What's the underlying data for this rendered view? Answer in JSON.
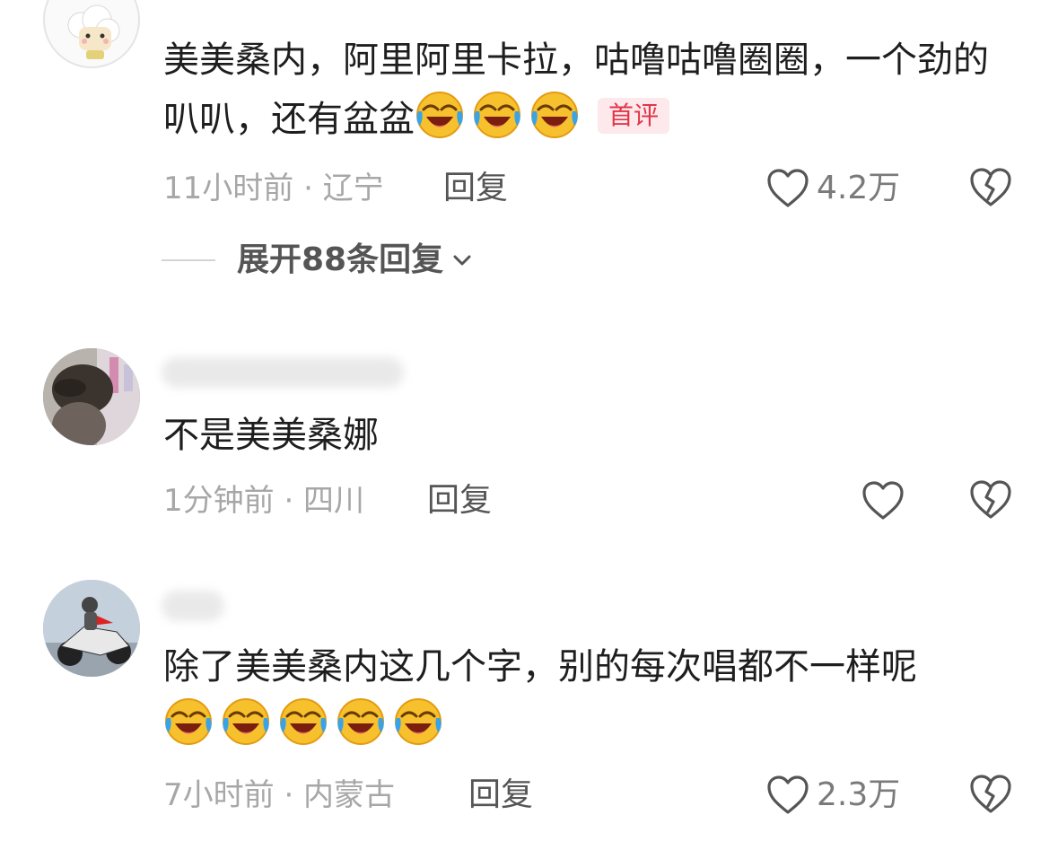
{
  "comments": [
    {
      "text": "美美桑内，阿里阿里卡拉，咕噜咕噜圈圈，一个劲的叭叭，还有盆盆",
      "emoji": [
        "laugh-cry",
        "laugh-cry",
        "laugh-cry"
      ],
      "badge": "首评",
      "meta": "11小时前 · 辽宁",
      "reply": "回复",
      "likes": "4.2万",
      "expand": "展开88条回复"
    },
    {
      "text": "不是美美桑娜",
      "meta": "1分钟前 · 四川",
      "reply": "回复",
      "likes": ""
    },
    {
      "text": "除了美美桑内这几个字，别的每次唱都不一样呢",
      "emoji": [
        "laugh-cry",
        "laugh-cry",
        "laugh-cry",
        "laugh-cry",
        "laugh-cry"
      ],
      "meta": "7小时前 · 内蒙古",
      "reply": "回复",
      "likes": "2.3万"
    }
  ],
  "colors": {
    "badge_text": "#e3354b",
    "badge_bg": "#fde8eb",
    "meta_text": "#a7a7a7",
    "icon": "#555555"
  }
}
